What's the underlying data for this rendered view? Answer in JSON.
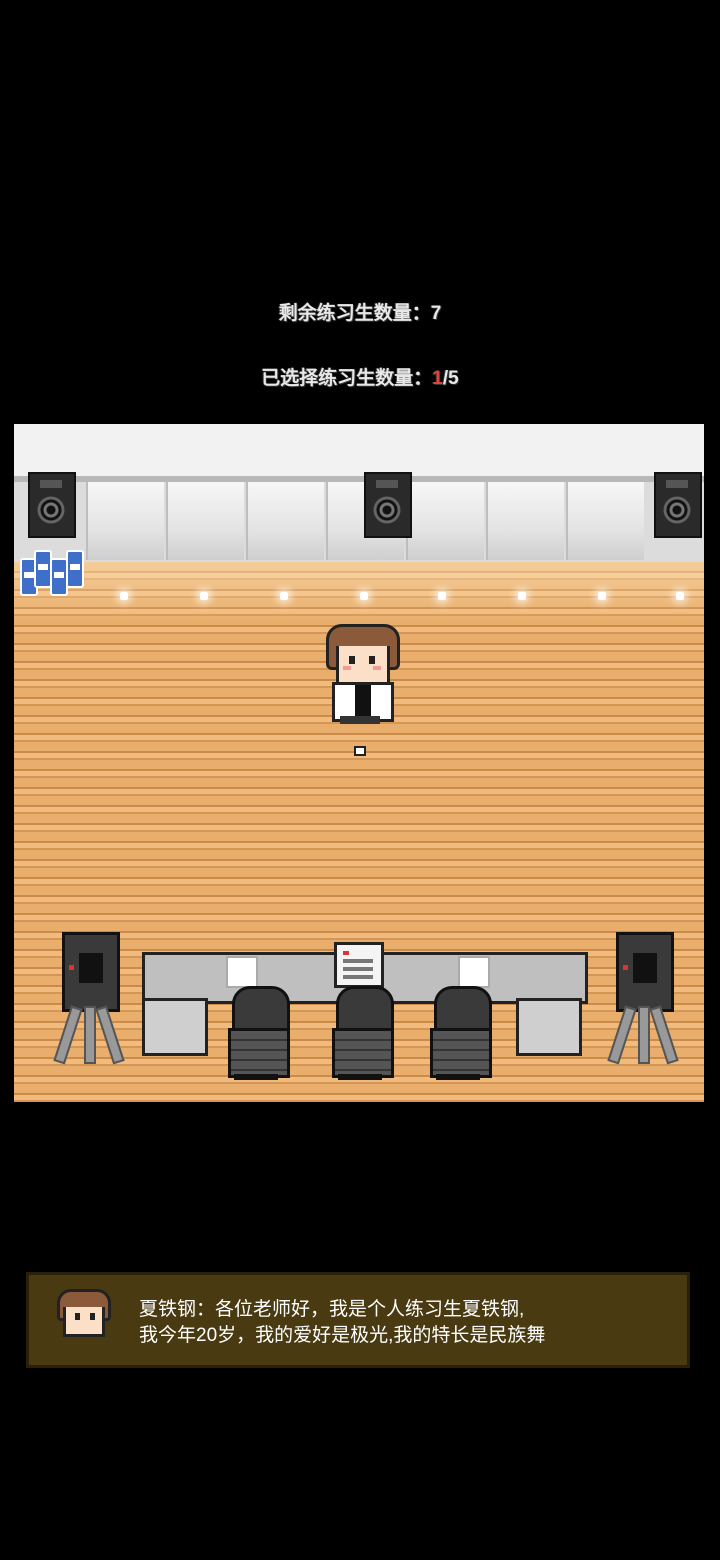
{
  "hud": {
    "remaining_label": "剩余练习生数量：",
    "remaining_value": "7",
    "selected_label": "已选择练习生数量：",
    "selected_current": "1",
    "selected_total": "/5"
  },
  "dialog": {
    "speaker": "夏铁钢",
    "line1": "夏铁钢：各位老师好，我是个人练习生夏铁钢,",
    "line2": "我今年20岁，我的爱好是极光,我的特长是民族舞"
  },
  "colors": {
    "background": "#000000",
    "dialog_box": "#4a3a12",
    "floor": "#e9ae6c",
    "highlight": "#e0443a"
  }
}
